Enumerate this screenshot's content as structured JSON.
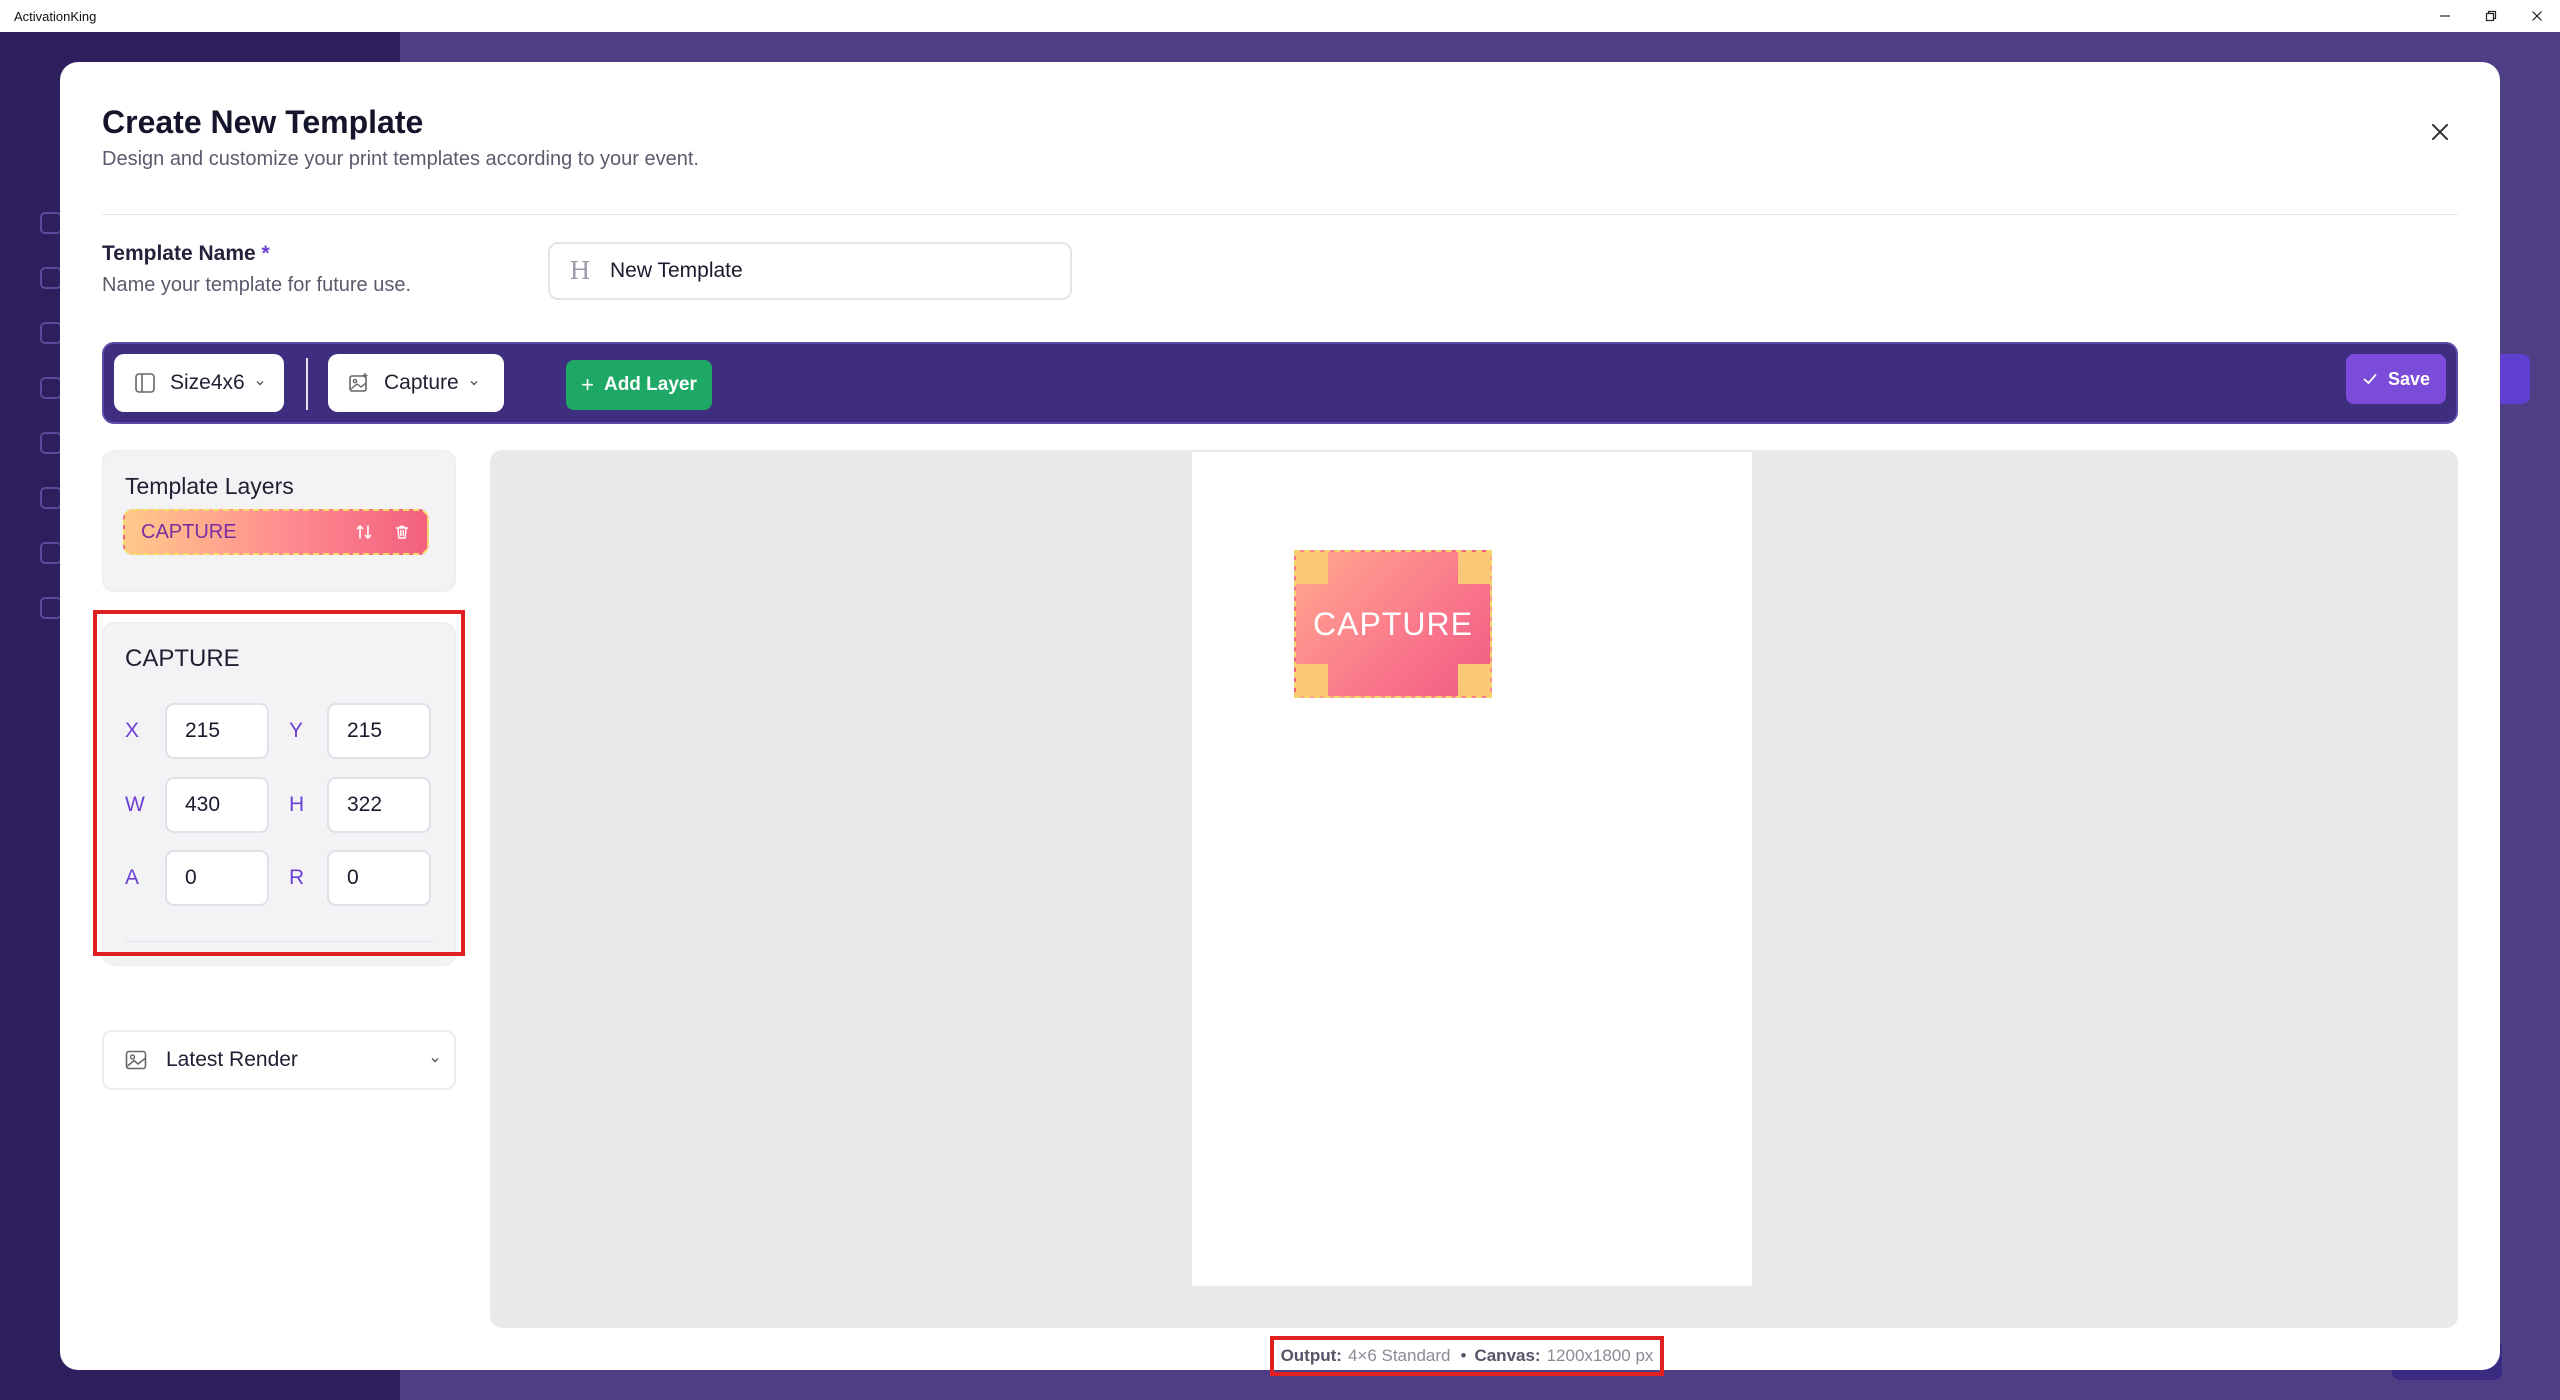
{
  "window": {
    "title": "ActivationKing"
  },
  "modal": {
    "title": "Create New Template",
    "subtitle": "Design and customize your print templates according to your event."
  },
  "template_name": {
    "label": "Template Name",
    "required_marker": "*",
    "hint": "Name your template for future use.",
    "value": "New Template"
  },
  "toolbar": {
    "size_select": "Size4x6",
    "layer_type_select": "Capture",
    "add_layer_label": "Add Layer",
    "save_label": "Save"
  },
  "layers_panel": {
    "title": "Template Layers",
    "items": [
      {
        "name": "CAPTURE"
      }
    ]
  },
  "properties": {
    "title": "CAPTURE",
    "x": {
      "label": "X",
      "value": "215"
    },
    "y": {
      "label": "Y",
      "value": "215"
    },
    "w": {
      "label": "W",
      "value": "430"
    },
    "h": {
      "label": "H",
      "value": "322"
    },
    "a": {
      "label": "A",
      "value": "0"
    },
    "r": {
      "label": "R",
      "value": "0"
    }
  },
  "render_select": {
    "label": "Latest Render"
  },
  "canvas": {
    "element_label": "CAPTURE",
    "output_label": "Output:",
    "output_value": "4×6 Standard",
    "canvas_label": "Canvas:",
    "canvas_value": "1200x1800 px"
  },
  "colors": {
    "toolbar_bg": "#3f2e7f",
    "accent_purple": "#7a4cd9",
    "add_green": "#1ea866",
    "highlight_red": "#e02020"
  }
}
